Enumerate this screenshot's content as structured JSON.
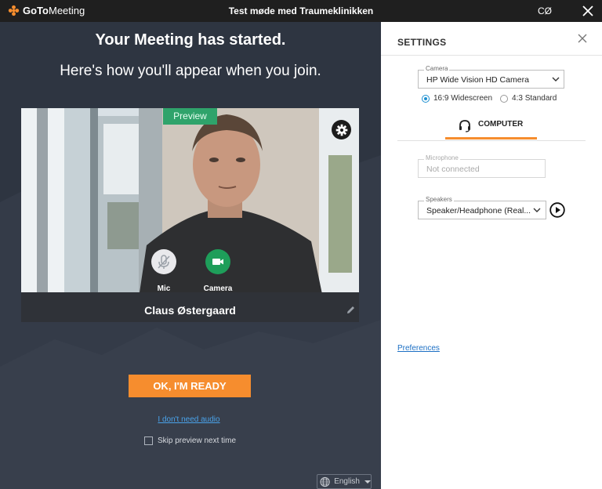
{
  "titlebar": {
    "app_name_bold": "GoTo",
    "app_name_rest": "Meeting",
    "window_title": "Test møde med Traumeklinikken",
    "user_initials": "CØ"
  },
  "preview": {
    "headline": "Your Meeting has started.",
    "subheadline": "Here's how you'll appear when you join.",
    "preview_tag": "Preview",
    "mic_label": "Mic",
    "camera_label": "Camera",
    "participant_name": "Claus Østergaard",
    "ready_button": "OK, I'M READY",
    "no_audio_link": "I don't need audio",
    "skip_checkbox_label": "Skip preview next time",
    "skip_checked": false,
    "language": "English"
  },
  "settings": {
    "title": "SETTINGS",
    "camera": {
      "legend": "Camera",
      "value": "HP Wide Vision HD Camera"
    },
    "aspect_options": [
      {
        "label": "16:9 Widescreen",
        "selected": true
      },
      {
        "label": "4:3 Standard",
        "selected": false
      }
    ],
    "audio_tab": "COMPUTER",
    "microphone": {
      "legend": "Microphone",
      "value": "Not connected"
    },
    "speakers": {
      "legend": "Speakers",
      "value": "Speaker/Headphone (Real..."
    },
    "preferences_link": "Preferences"
  },
  "colors": {
    "accent_orange": "#f68d2e",
    "camera_green": "#1e9e5a",
    "link_blue": "#1c6fc4",
    "panel_dark": "#2e3541"
  }
}
